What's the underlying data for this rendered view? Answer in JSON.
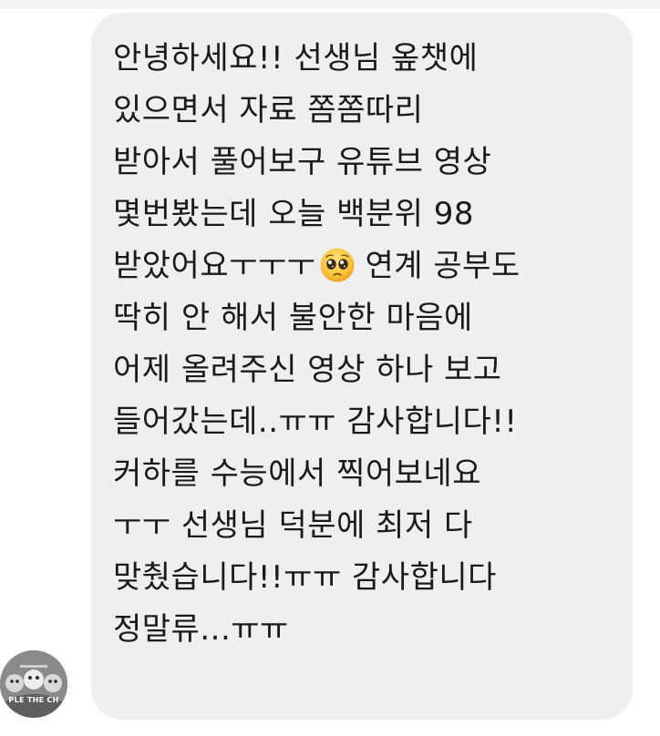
{
  "chat": {
    "message": {
      "lines": [
        "안녕하세요!! 선생님 옾챗에",
        "있으면서 자료 쫌쫌따리",
        "받아서 풀어보구 유튜브 영상",
        "몇번봤는데 오늘 백분위 98",
        "받았어요ㅜㅜㅜ",
        "연계 공부도",
        "딱히 안 해서 불안한 마음에",
        "어제 올려주신 영상 하나 보고",
        "들어갔는데..ㅠㅠ 감사합니다!!",
        "커하를 수능에서 찍어보네요",
        "ㅜㅜ 선생님 덕분에 최저 다",
        "맞췄습니다!!ㅠㅠ 감사합니다",
        "정말류...ㅠㅠ"
      ],
      "emoji": "pleading-face-icon",
      "bubble_color": "#efeff1",
      "text_color": "#1a1a1a"
    },
    "sender": {
      "avatar_caption": "PLE THE CH"
    }
  }
}
